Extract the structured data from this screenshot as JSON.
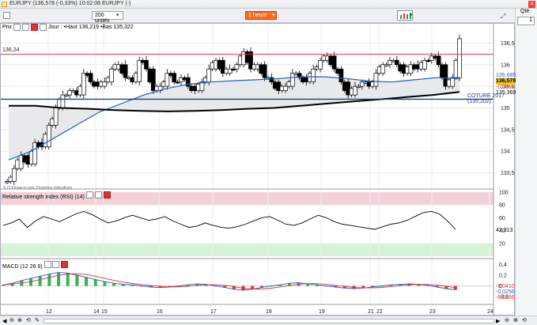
{
  "window": {
    "title": "EURJPY (136,578 (-0,33%) 10:02:08 EURJPY (-)"
  },
  "toolbar": {
    "units_value": "200 unités",
    "interval_value": "1 heure",
    "qty_label": "Qté",
    "qty_value": "1"
  },
  "legend": {
    "prix_label": "Prix",
    "ohlc_text": "Jour : •Haut 136,219 •Bas 135,322",
    "credit": "© IT-Finance.com. Données indicatives"
  },
  "price_labels": {
    "level_13624": "136,24",
    "current": "136,578",
    "ma_value": "135,685",
    "pct_change": "-0,33%",
    "ma_long_value": "135,369",
    "coture_label": "COTURE 2017 (135,202)"
  },
  "rsi": {
    "title": "Relative strength index (RSI) (14)",
    "value": "42,313"
  },
  "macd": {
    "title": "MACD (12 26 9)",
    "v1": "-0,0410",
    "v2": "-0,0256",
    "v3": "-0,0666"
  },
  "chart_data": [
    {
      "type": "candlestick",
      "series_name": "EURJPY",
      "x_ticks": [
        "12",
        "14",
        "15",
        "16",
        "17",
        "18",
        "19",
        "21",
        "22",
        "23",
        "24"
      ],
      "y_ticks": [
        133.5,
        134,
        134.5,
        135,
        135.5,
        136,
        136.5
      ],
      "ylim": [
        133.2,
        136.8
      ],
      "close_path": [
        133.3,
        133.6,
        133.9,
        133.7,
        134.2,
        134.1,
        134.6,
        135.0,
        135.3,
        135.4,
        135.3,
        135.8,
        135.6,
        135.5,
        135.6,
        135.9,
        136.0,
        135.7,
        135.6,
        136.1,
        135.9,
        135.4,
        135.5,
        135.8,
        135.6,
        135.7,
        135.5,
        135.4,
        135.6,
        135.9,
        136.1,
        135.8,
        135.9,
        136.0,
        136.3,
        135.9,
        136.0,
        135.7,
        135.6,
        135.4,
        135.5,
        135.8,
        135.7,
        135.6,
        135.9,
        136.1,
        136.2,
        135.9,
        135.6,
        135.3,
        135.5,
        135.6,
        135.5,
        135.8,
        136.0,
        136.1,
        136.0,
        135.8,
        136.0,
        135.9,
        136.1,
        136.2,
        136.0,
        135.5,
        135.7,
        136.6
      ],
      "ma_medium": [
        133.8,
        134.0,
        134.3,
        134.6,
        134.9,
        135.1,
        135.3,
        135.45,
        135.55,
        135.6,
        135.63,
        135.65,
        135.68,
        135.72,
        135.72,
        135.68,
        135.62,
        135.6,
        135.65,
        135.7,
        135.68
      ],
      "ma_long": [
        135.05,
        135.05,
        135.0,
        134.98,
        134.95,
        134.93,
        134.92,
        134.93,
        134.95,
        134.98,
        135.0,
        135.05,
        135.1,
        135.15,
        135.2,
        135.25,
        135.3,
        135.37
      ],
      "horizontal_levels": [
        {
          "value": 136.24,
          "color": "#d93a3a"
        },
        {
          "value": 135.202,
          "color": "#1f3b8c"
        }
      ]
    },
    {
      "type": "line",
      "title": "Relative strength index (RSI) (14)",
      "y_ticks": [
        20,
        40,
        60,
        80,
        100
      ],
      "ylim": [
        0,
        100
      ],
      "bands": [
        {
          "from": 80,
          "to": 100,
          "color": "#f3d2d7"
        },
        {
          "from": 0,
          "to": 20,
          "color": "#d6f3d9"
        }
      ],
      "values": [
        48,
        52,
        58,
        45,
        55,
        62,
        58,
        54,
        60,
        66,
        70,
        65,
        58,
        52,
        55,
        60,
        64,
        60,
        56,
        58,
        62,
        55,
        50,
        45,
        47,
        52,
        48,
        45,
        44,
        46,
        50,
        55,
        60,
        62,
        56,
        50,
        48,
        52,
        58,
        64,
        60,
        54,
        50,
        48,
        46,
        44,
        42,
        46,
        50,
        52,
        56,
        62,
        68,
        70,
        66,
        55,
        42
      ]
    },
    {
      "type": "histogram",
      "title": "MACD (12 26 9)",
      "y_ticks": [
        0.4,
        0.2,
        0,
        -0.2
      ],
      "ylim": [
        -0.3,
        0.45
      ],
      "values": [
        0.02,
        0.05,
        0.1,
        0.14,
        0.18,
        0.22,
        0.25,
        0.24,
        0.2,
        0.16,
        0.12,
        0.08,
        0.05,
        0.03,
        0.02,
        0.0,
        -0.02,
        -0.03,
        -0.02,
        0.0,
        0.02,
        0.04,
        0.03,
        0.0,
        -0.03,
        -0.06,
        -0.08,
        -0.06,
        -0.03,
        0.0,
        0.02,
        0.05,
        0.06,
        0.04,
        0.02,
        0.0,
        -0.02,
        -0.04,
        -0.05,
        -0.04,
        -0.02,
        0.0,
        0.02,
        0.03,
        0.04,
        0.03,
        0.01,
        -0.02,
        -0.05,
        -0.07
      ]
    }
  ]
}
